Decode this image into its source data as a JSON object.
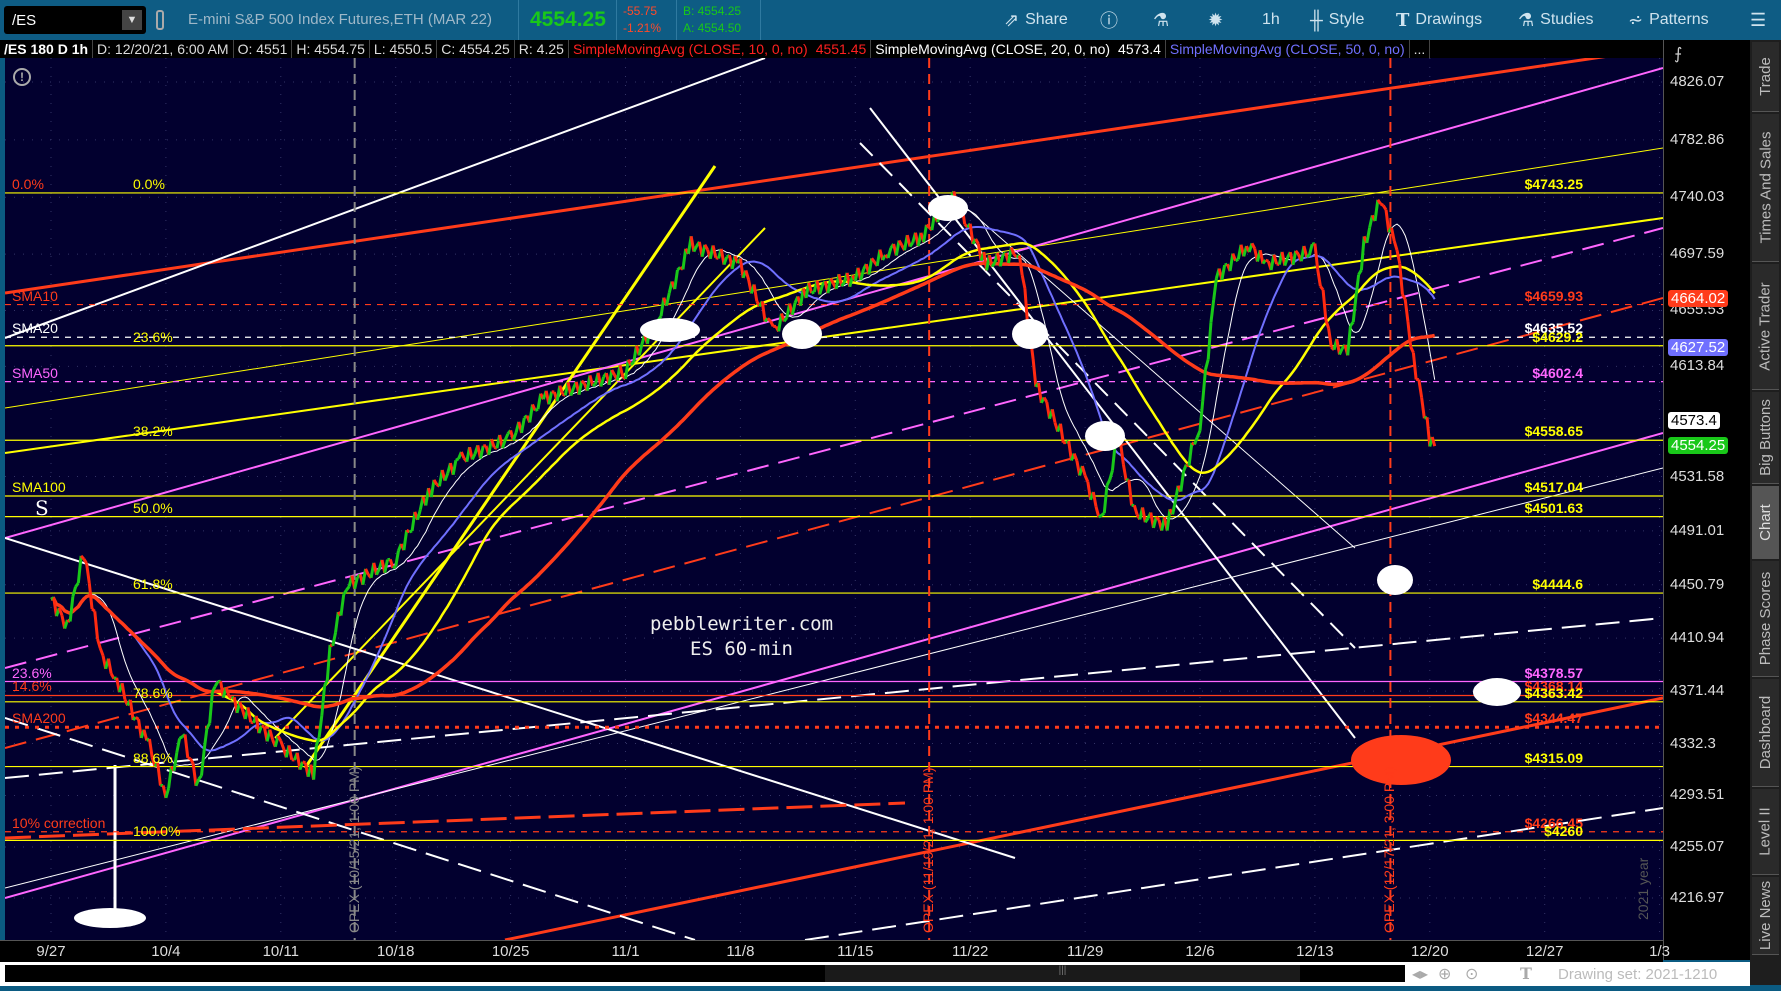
{
  "toolbar": {
    "symbol": "/ES",
    "description": "E-mini S&P 500 Index Futures,ETH (MAR 22)",
    "last": "4554.25",
    "net_change": "-55.75",
    "pct_change": "-1.21%",
    "bid": "B: 4554.25",
    "ask": "A: 4554.50",
    "buttons": [
      {
        "label": "Share",
        "icon": "share-icon"
      },
      {
        "label": "",
        "icon": "info-icon"
      },
      {
        "label": "",
        "icon": "flask-icon"
      },
      {
        "label": "",
        "icon": "gear-icon"
      },
      {
        "label": "1h",
        "icon": ""
      },
      {
        "label": "Style",
        "icon": "candle-icon"
      },
      {
        "label": "Drawings",
        "icon": "text-t-icon"
      },
      {
        "label": "Studies",
        "icon": "flask-icon"
      },
      {
        "label": "Patterns",
        "icon": "patterns-icon"
      },
      {
        "label": "",
        "icon": "menu-icon"
      }
    ]
  },
  "infobar": {
    "title": "/ES 180 D 1h",
    "date": "D: 12/20/21, 6:00 AM",
    "open": "O: 4551",
    "high": "H: 4554.75",
    "low": "L: 4550.5",
    "close": "C: 4554.25",
    "range": "R: 4.25",
    "study1": "SimpleMovingAvg (CLOSE, 10, 0, no)",
    "study1_val": "4551.45",
    "study2": "SimpleMovingAvg (CLOSE, 20, 0, no)",
    "study2_val": "4573.4",
    "study3": "SimpleMovingAvg (CLOSE, 50, 0, no)",
    "more": "..."
  },
  "colors": {
    "bg": "#02002f",
    "red": "#ff3b1a",
    "yellow": "#ffff00",
    "magenta": "#ff66ff",
    "white": "#ffffff",
    "blue": "#7070ff",
    "green": "#19c819"
  },
  "price_axis": {
    "ticks": [
      "4826.07",
      "4782.86",
      "4740.03",
      "4697.59",
      "4655.53",
      "4613.84",
      "4531.58",
      "4491.01",
      "4450.79",
      "4410.94",
      "4371.44",
      "4332.3",
      "4293.51",
      "4255.07",
      "4216.97"
    ],
    "badges": [
      {
        "value": "4664.02",
        "bg": "#ff3b1a",
        "fg": "#fff"
      },
      {
        "value": "4627.52",
        "bg": "#7070ff",
        "fg": "#fff"
      },
      {
        "value": "4573.4",
        "bg": "#ffffff",
        "fg": "#000"
      },
      {
        "value": "4554.25",
        "bg": "#19c819",
        "fg": "#fff"
      }
    ]
  },
  "date_axis": [
    "9/27",
    "10/4",
    "10/11",
    "10/18",
    "10/25",
    "11/1",
    "11/8",
    "11/15",
    "11/22",
    "11/29",
    "12/6",
    "12/13",
    "12/20",
    "12/27",
    "1/3"
  ],
  "levels": [
    {
      "label": "$4743.25",
      "price": 4743.25,
      "color": "#ffff00",
      "style": "solid"
    },
    {
      "label": "$4659.93",
      "price": 4659.93,
      "color": "#ff3b1a",
      "style": "dash"
    },
    {
      "label": "$4635.52",
      "price": 4635.52,
      "color": "#ffffff",
      "style": "dash"
    },
    {
      "label": "$4629.2",
      "price": 4629.2,
      "color": "#ffff00",
      "style": "solid"
    },
    {
      "label": "$4602.4",
      "price": 4602.4,
      "color": "#ff66ff",
      "style": "dash"
    },
    {
      "label": "$4558.65",
      "price": 4558.65,
      "color": "#ffff00",
      "style": "solid"
    },
    {
      "label": "$4517.04",
      "price": 4517.04,
      "color": "#ffff00",
      "style": "solid"
    },
    {
      "label": "$4501.63",
      "price": 4501.63,
      "color": "#ffff00",
      "style": "solid"
    },
    {
      "label": "$4444.6",
      "price": 4444.6,
      "color": "#ffff00",
      "style": "solid"
    },
    {
      "label": "$4378.57",
      "price": 4378.57,
      "color": "#ff66ff",
      "style": "solid"
    },
    {
      "label": "$4368.14",
      "price": 4368.14,
      "color": "#ff3b1a",
      "style": "solid"
    },
    {
      "label": "$4363.42",
      "price": 4363.42,
      "color": "#ffff00",
      "style": "solid"
    },
    {
      "label": "$4344.47",
      "price": 4344.47,
      "color": "#ff3b1a",
      "style": "dot"
    },
    {
      "label": "$4315.09",
      "price": 4315.09,
      "color": "#ffff00",
      "style": "solid"
    },
    {
      "label": "$4266.45",
      "price": 4266.45,
      "color": "#ff3b1a",
      "style": "dash"
    },
    {
      "label": "$4260",
      "price": 4260,
      "color": "#ffff00",
      "style": "solid"
    }
  ],
  "left_labels": [
    {
      "label": "0.0%",
      "price": 4743.25,
      "color": "#ff3b1a",
      "col": 0
    },
    {
      "label": "0.0%",
      "price": 4743.25,
      "color": "#ffff00",
      "col": 1
    },
    {
      "label": "SMA10",
      "price": 4659.93,
      "color": "#ff3b1a",
      "col": 0
    },
    {
      "label": "SMA20",
      "price": 4635.52,
      "color": "#ffffff",
      "col": 0
    },
    {
      "label": "23.6%",
      "price": 4629.2,
      "color": "#ffff00",
      "col": 1
    },
    {
      "label": "SMA50",
      "price": 4602.4,
      "color": "#ff66ff",
      "col": 0
    },
    {
      "label": "38.2%",
      "price": 4558.65,
      "color": "#ffff00",
      "col": 1
    },
    {
      "label": "SMA100",
      "price": 4517.04,
      "color": "#ffff00",
      "col": 0
    },
    {
      "label": "50.0%",
      "price": 4501.63,
      "color": "#ffff00",
      "col": 1
    },
    {
      "label": "61.8%",
      "price": 4444.6,
      "color": "#ffff00",
      "col": 1
    },
    {
      "label": "23.6%",
      "price": 4378.57,
      "color": "#ff66ff",
      "col": 0
    },
    {
      "label": "14.6%",
      "price": 4368.14,
      "color": "#ff3b1a",
      "col": 0
    },
    {
      "label": "78.6%",
      "price": 4363.42,
      "color": "#ffff00",
      "col": 1
    },
    {
      "label": "SMA200",
      "price": 4344.47,
      "color": "#ff3b1a",
      "col": 0
    },
    {
      "label": "88.6%",
      "price": 4315.09,
      "color": "#ffff00",
      "col": 1
    },
    {
      "label": "10% correction",
      "price": 4266.45,
      "color": "#ff3b1a",
      "col": 0
    },
    {
      "label": "100.0%",
      "price": 4260,
      "color": "#ffff00",
      "col": 1
    }
  ],
  "events": [
    {
      "label": "OPEX (10/15/21, 1:00 PM)",
      "day": 18.5,
      "color": "#888888"
    },
    {
      "label": "OPEX (11/19/21, 1:00 PM)",
      "day": 53.5,
      "color": "#ff3b1a"
    },
    {
      "label": "OPEX (12/17/21, 3:00 PM)",
      "day": 81.6,
      "color": "#ff3b1a"
    }
  ],
  "year_label": "2021 year",
  "s_label": "S",
  "watermark": {
    "line1": "pebblewriter.com",
    "line2": "ES 60-min"
  },
  "price_series": [
    [
      0,
      4440
    ],
    [
      1,
      4420
    ],
    [
      2,
      4476
    ],
    [
      3,
      4400
    ],
    [
      4,
      4380
    ],
    [
      6,
      4330
    ],
    [
      7,
      4294
    ],
    [
      8,
      4340
    ],
    [
      9,
      4300
    ],
    [
      10,
      4380
    ],
    [
      11,
      4365
    ],
    [
      14,
      4330
    ],
    [
      16,
      4310
    ],
    [
      17,
      4400
    ],
    [
      18,
      4450
    ],
    [
      21,
      4470
    ],
    [
      23,
      4520
    ],
    [
      25,
      4545
    ],
    [
      28,
      4560
    ],
    [
      30,
      4590
    ],
    [
      35,
      4610
    ],
    [
      37,
      4650
    ],
    [
      39,
      4705
    ],
    [
      42,
      4690
    ],
    [
      44,
      4640
    ],
    [
      46,
      4670
    ],
    [
      49,
      4680
    ],
    [
      51,
      4700
    ],
    [
      53,
      4710
    ],
    [
      55,
      4740
    ],
    [
      57,
      4690
    ],
    [
      59,
      4700
    ],
    [
      60,
      4600
    ],
    [
      63,
      4530
    ],
    [
      64,
      4500
    ],
    [
      65,
      4560
    ],
    [
      66,
      4505
    ],
    [
      68,
      4495
    ],
    [
      70,
      4570
    ],
    [
      71,
      4680
    ],
    [
      73,
      4705
    ],
    [
      74,
      4690
    ],
    [
      77,
      4700
    ],
    [
      78,
      4630
    ],
    [
      79,
      4625
    ],
    [
      80,
      4705
    ],
    [
      81,
      4740
    ],
    [
      82,
      4700
    ],
    [
      83,
      4620
    ],
    [
      84,
      4560
    ],
    [
      84.3,
      4554.25
    ]
  ],
  "sidebar": {
    "tabs": [
      "Trade",
      "Times And Sales",
      "Active Trader",
      "Big Buttons",
      "Chart",
      "Phase Scores",
      "Dashboard",
      "Level II",
      "Live News"
    ],
    "active": "Chart"
  },
  "bottom": {
    "drawing_set": "Drawing set: 2021-1210"
  }
}
